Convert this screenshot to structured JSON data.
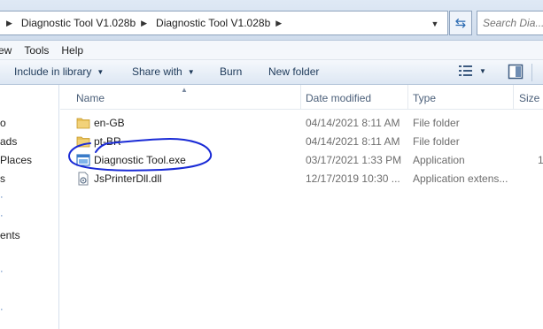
{
  "address_bar": {
    "breadcrumbs": [
      "Diagnostic Tool V1.028b",
      "Diagnostic Tool V1.028b"
    ],
    "search_placeholder": "Search Dia..."
  },
  "menu": [
    "ew",
    "Tools",
    "Help"
  ],
  "toolbar": {
    "include_in_library": "Include in library",
    "share_with": "Share with",
    "burn": "Burn",
    "new_folder": "New folder"
  },
  "nav_pane": {
    "items": [
      "o",
      "ads",
      "Places",
      "s",
      "ents"
    ]
  },
  "columns": {
    "name": "Name",
    "date_modified": "Date modified",
    "type": "Type",
    "size": "Size"
  },
  "files": [
    {
      "name": "en-GB",
      "date": "04/14/2021 8:11 AM",
      "type": "File folder",
      "size": "",
      "icon": "folder-icon"
    },
    {
      "name": "pt-BR",
      "date": "04/14/2021 8:11 AM",
      "type": "File folder",
      "size": "",
      "icon": "folder-icon"
    },
    {
      "name": "Diagnostic Tool.exe",
      "date": "03/17/2021 1:33 PM",
      "type": "Application",
      "size": "1",
      "icon": "application-icon"
    },
    {
      "name": "JsPrinterDll.dll",
      "date": "12/17/2019 10:30 ...",
      "type": "Application extens...",
      "size": "",
      "icon": "dll-icon"
    }
  ],
  "colors": {
    "highlight_circle": "#1a2bd6",
    "folder": "#e8c15a",
    "address_bg": "#dfe9f5"
  }
}
